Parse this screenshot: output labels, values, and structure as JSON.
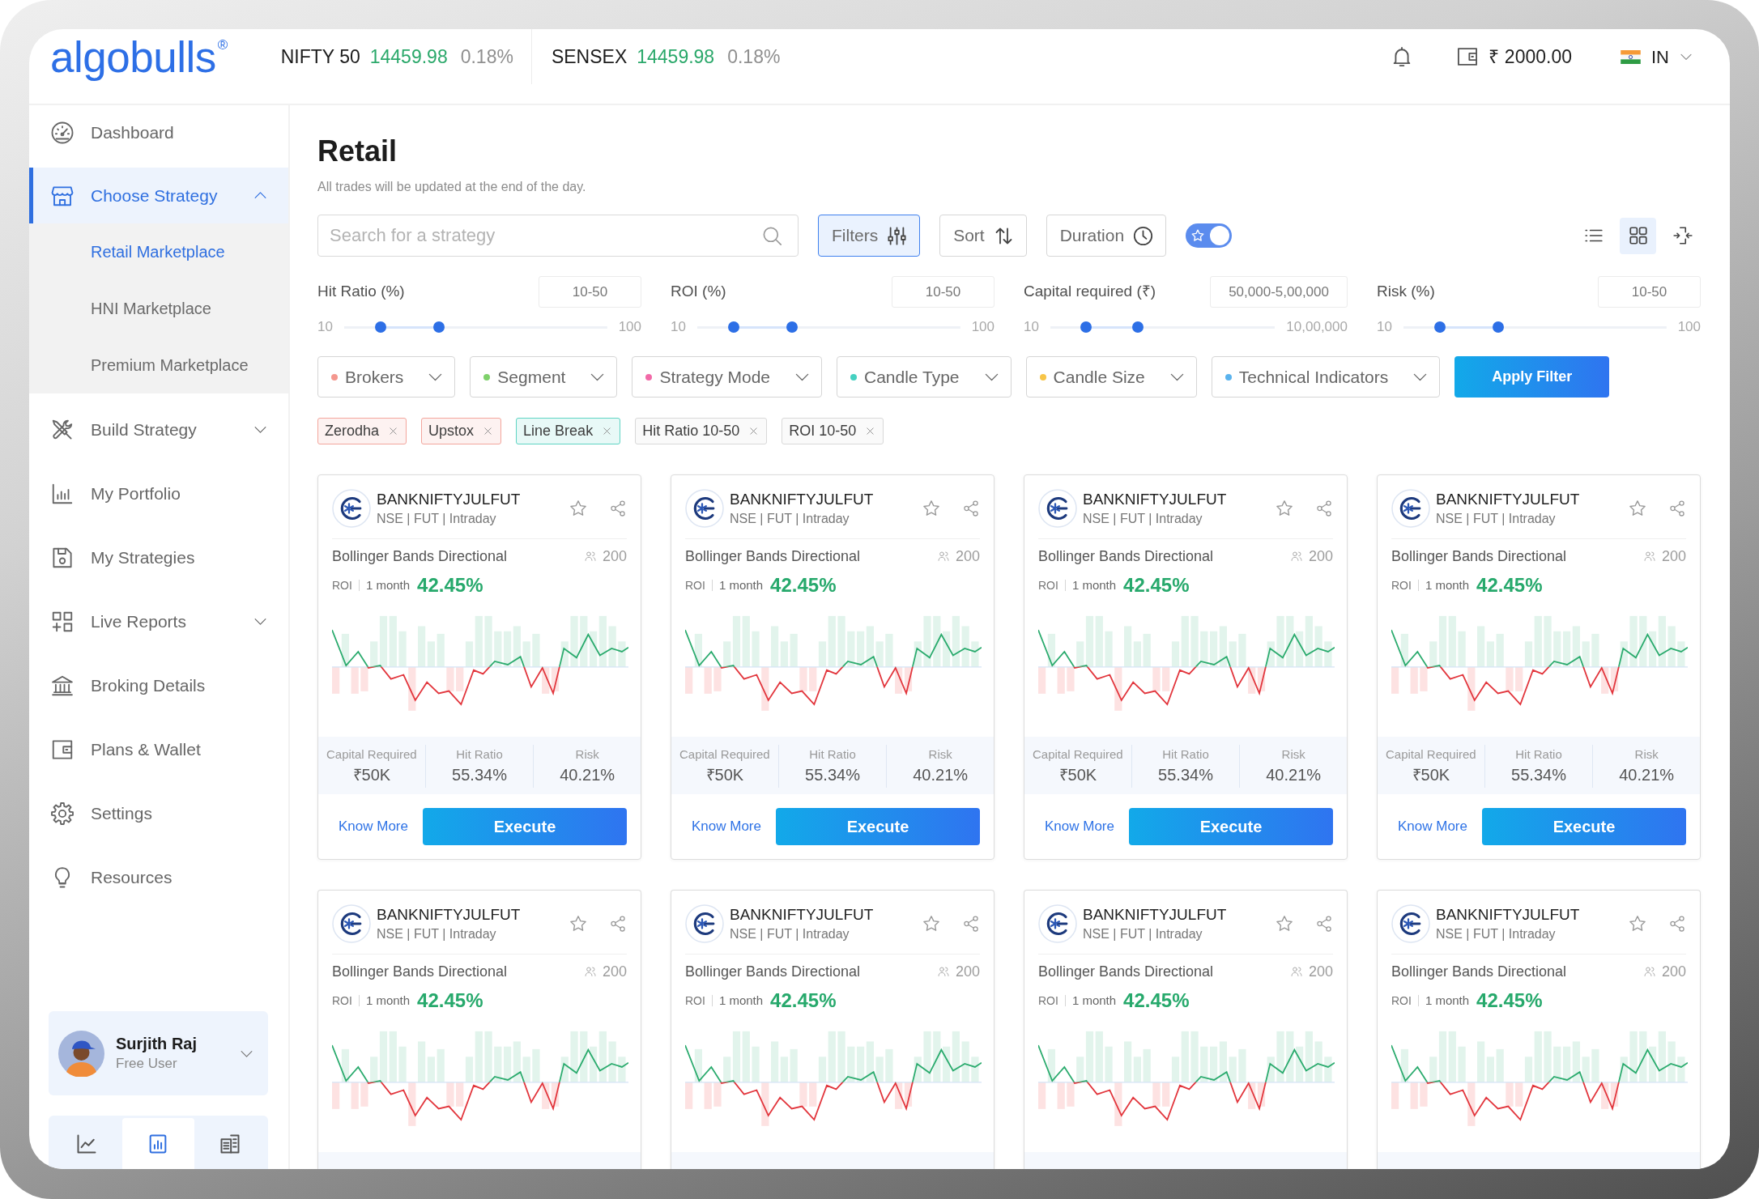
{
  "header": {
    "logo": "algobulls$^{®}$",
    "tickers": [
      {
        "name": "NIFTY 50",
        "value": "14459.98",
        "change": "0.18%"
      },
      {
        "name": "SENSEX",
        "value": "14459.98",
        "change": "0.18%"
      }
    ],
    "wallet_balance": "₹ 2000.00",
    "region": "IN"
  },
  "sidebar": {
    "items": [
      {
        "label": "Dashboard",
        "selected": false
      },
      {
        "label": "Choose Strategy",
        "selected": true,
        "expanded": true,
        "children": [
          {
            "label": "Retail Marketplace",
            "selected": true
          },
          {
            "label": "HNI Marketplace",
            "selected": false
          },
          {
            "label": "Premium Marketplace",
            "selected": false
          }
        ]
      },
      {
        "label": "Build Strategy",
        "selected": false,
        "expanded": false
      },
      {
        "label": "My Portfolio",
        "selected": false
      },
      {
        "label": "My Strategies",
        "selected": false
      },
      {
        "label": "Live Reports",
        "selected": false,
        "expanded": false
      },
      {
        "label": "Broking Details",
        "selected": false
      },
      {
        "label": "Plans & Wallet",
        "selected": false
      },
      {
        "label": "Settings",
        "selected": false
      },
      {
        "label": "Resources",
        "selected": false
      }
    ],
    "user": {
      "name": "Surjith Raj",
      "plan": "Free User"
    },
    "bottom_tabs": [
      {
        "selected": false
      },
      {
        "selected": true
      },
      {
        "selected": false
      }
    ]
  },
  "page": {
    "title": "Retail",
    "subtitle": "All trades will be updated at the end of the day.",
    "search": {
      "placeholder": "Search for a strategy"
    },
    "toolbar_buttons": [
      {
        "label": "Filters",
        "selected": true
      },
      {
        "label": "Sort",
        "selected": false
      },
      {
        "label": "Duration",
        "selected": false
      }
    ],
    "favorites_toggle": {
      "on": true
    },
    "view_modes": [
      {
        "kind": "list",
        "selected": false
      },
      {
        "kind": "grid",
        "selected": true
      }
    ],
    "range_filters": [
      {
        "label": "Hit Ratio (%)",
        "value": "10-50",
        "min": "10",
        "max": "100",
        "thumbs": [
          {
            "level": 0.14
          },
          {
            "level": 0.36
          }
        ]
      },
      {
        "label": "ROI (%)",
        "value": "10-50",
        "min": "10",
        "max": "100",
        "thumbs": [
          {
            "level": 0.14
          },
          {
            "level": 0.36
          }
        ]
      },
      {
        "label": "Capital required (₹)",
        "value": "50,000-5,00,000",
        "min": "10",
        "max": "10,00,000",
        "thumbs": [
          {
            "level": 0.16
          },
          {
            "level": 0.39
          }
        ]
      },
      {
        "label": "Risk (%)",
        "value": "10-50",
        "min": "10",
        "max": "100",
        "thumbs": [
          {
            "level": 0.14
          },
          {
            "level": 0.36
          }
        ]
      }
    ],
    "dropdowns": [
      {
        "label": "Brokers",
        "color": "#f4978e"
      },
      {
        "label": "Segment",
        "color": "#7fd16b"
      },
      {
        "label": "Strategy Mode",
        "color": "#f26aa8"
      },
      {
        "label": "Candle Type",
        "color": "#45d1c1"
      },
      {
        "label": "Candle Size",
        "color": "#f7c548"
      },
      {
        "label": "Technical Indicators",
        "color": "#5ab3ee"
      }
    ],
    "apply_button": "Apply Filter",
    "chips": [
      {
        "label": "Zerodha",
        "color": "#f3a69d"
      },
      {
        "label": "Upstox",
        "color": "#f3a69d"
      },
      {
        "label": "Line Break",
        "color": "#5fd4c3"
      },
      {
        "label": "Hit Ratio 10-50",
        "color": "#d9d9d9"
      },
      {
        "label": "ROI 10-50",
        "color": "#d9d9d9"
      }
    ],
    "cards": [
      {
        "symbol": "BANKNIFTYJULFUT",
        "segment": "NSE | FUT | Intraday",
        "strategy": "Bollinger Bands Directional",
        "followers": "200",
        "roi_label": "ROI",
        "roi_period": "1 month",
        "roi": "42.45%",
        "stats": [
          {
            "label": "Capital Required",
            "value": "₹50K"
          },
          {
            "label": "Hit Ratio",
            "value": "55.34%"
          },
          {
            "label": "Risk",
            "value": "40.21%"
          }
        ],
        "link": "Know More",
        "action": "Execute"
      },
      {
        "symbol": "BANKNIFTYJULFUT",
        "segment": "NSE | FUT | Intraday",
        "strategy": "Bollinger Bands Directional",
        "followers": "200",
        "roi_label": "ROI",
        "roi_period": "1 month",
        "roi": "42.45%",
        "stats": [
          {
            "label": "Capital Required",
            "value": "₹50K"
          },
          {
            "label": "Hit Ratio",
            "value": "55.34%"
          },
          {
            "label": "Risk",
            "value": "40.21%"
          }
        ],
        "link": "Know More",
        "action": "Execute"
      },
      {
        "symbol": "BANKNIFTYJULFUT",
        "segment": "NSE | FUT | Intraday",
        "strategy": "Bollinger Bands Directional",
        "followers": "200",
        "roi_label": "ROI",
        "roi_period": "1 month",
        "roi": "42.45%",
        "stats": [
          {
            "label": "Capital Required",
            "value": "₹50K"
          },
          {
            "label": "Hit Ratio",
            "value": "55.34%"
          },
          {
            "label": "Risk",
            "value": "40.21%"
          }
        ],
        "link": "Know More",
        "action": "Execute"
      },
      {
        "symbol": "BANKNIFTYJULFUT",
        "segment": "NSE | FUT | Intraday",
        "strategy": "Bollinger Bands Directional",
        "followers": "200",
        "roi_label": "ROI",
        "roi_period": "1 month",
        "roi": "42.45%",
        "stats": [
          {
            "label": "Capital Required",
            "value": "₹50K"
          },
          {
            "label": "Hit Ratio",
            "value": "55.34%"
          },
          {
            "label": "Risk",
            "value": "40.21%"
          }
        ],
        "link": "Know More",
        "action": "Execute"
      },
      {
        "symbol": "BANKNIFTYJULFUT",
        "segment": "NSE | FUT | Intraday",
        "strategy": "Bollinger Bands Directional",
        "followers": "200",
        "roi_label": "ROI",
        "roi_period": "1 month",
        "roi": "42.45%"
      },
      {
        "symbol": "BANKNIFTYJULFUT",
        "segment": "NSE | FUT | Intraday",
        "strategy": "Bollinger Bands Directional",
        "followers": "200",
        "roi_label": "ROI",
        "roi_period": "1 month",
        "roi": "42.45%"
      },
      {
        "symbol": "BANKNIFTYJULFUT",
        "segment": "NSE | FUT | Intraday",
        "strategy": "Bollinger Bands Directional",
        "followers": "200",
        "roi_label": "ROI",
        "roi_period": "1 month",
        "roi": "42.45%"
      },
      {
        "symbol": "BANKNIFTYJULFUT",
        "segment": "NSE | FUT | Intraday",
        "strategy": "Bollinger Bands Directional",
        "followers": "200",
        "roi_label": "ROI",
        "roi_period": "1 month",
        "roi": "42.45%"
      }
    ]
  }
}
